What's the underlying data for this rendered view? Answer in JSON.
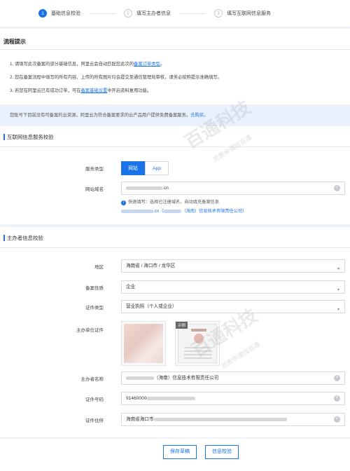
{
  "steps": [
    {
      "num": "1",
      "label": "基础信息校验"
    },
    {
      "num": "2",
      "label": "填写主办者信息"
    },
    {
      "num": "3",
      "label": "填写互联网信息服务"
    }
  ],
  "process": {
    "title": "流程提示",
    "tip1_text": "1. 请填写此次备案的部分基础信息，阿里云会自动匹配您此次的",
    "tip1_link": "备案订单类型",
    "tip1_end": "。",
    "tip2": "2. 您在备案流程中填写的所有内容、上传的所有图片均会提交至通信管理局审核，请务必按照提示准确填写。",
    "tip3_text": "3. 若您在阿里云已有成功订单，可在",
    "tip3_link": "备案基础设置",
    "tip3_end": "中开启资料复用功能。"
  },
  "notice": {
    "text": "您账号下目前没有可备案的云资源。阿里云为符合备案要求的云产品用户提供免费备案服务。",
    "link": "去购买。"
  },
  "internet": {
    "title": "互联网信息服务校验",
    "service_type_label": "服务类型",
    "service_types": [
      "网站",
      "App"
    ],
    "domain_label": "网站域名",
    "domain_suffix": ".cn",
    "hint_text": "快速填写：选择已注册域名，自动填充备案信息",
    "hint_domain_suffix": ".cn（",
    "hint_company": "（海南）信息技术有限责任公司）"
  },
  "sponsor": {
    "title": "主办者信息校验",
    "region_label": "地区",
    "region_value": "海南省 / 海口市 / 龙华区",
    "nature_label": "备案性质",
    "nature_value": "企业",
    "cert_type_label": "证件类型",
    "cert_type_value": "营业执照（个人或企业）",
    "unit_cert_label": "主办单位证件",
    "sample_tag": "示例",
    "name_label": "主办者名称",
    "name_value": "（海南）信息技术有限责任公司",
    "cert_no_label": "证件号码",
    "cert_no_value": "91460000",
    "address_label": "证件住所",
    "address_value": "海南省海口市"
  },
  "footer": {
    "save_label": "保存草稿",
    "verify_label": "信息校验"
  },
  "watermark": {
    "brand": "百通科技",
    "slogan": "资质申请找百通"
  },
  "colors": {
    "accent": "#1a73e8",
    "notice_bg": "#e9f1fc"
  },
  "icons": {
    "clear": "clear-icon",
    "dropdown": "chevron-down-icon",
    "hint": "info-badge-icon"
  }
}
